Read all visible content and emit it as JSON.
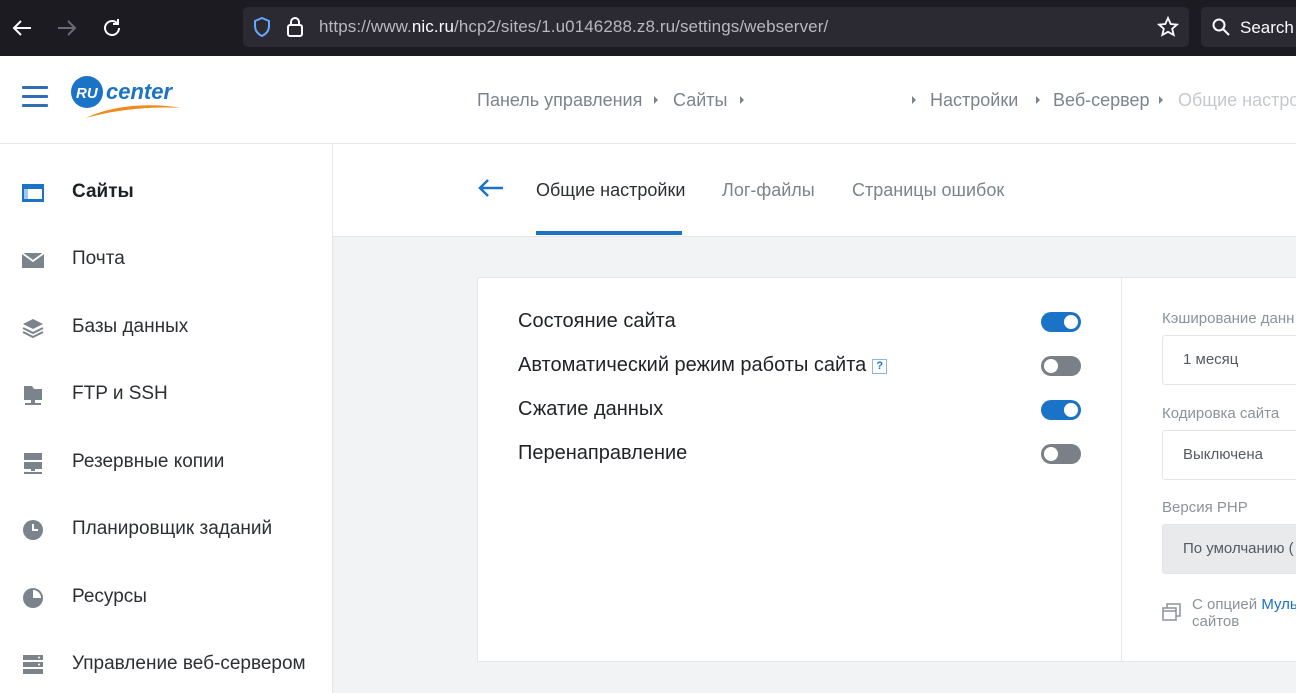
{
  "browser": {
    "url_prefix": "https://www.",
    "url_domain": "nic.ru",
    "url_path": "/hcp2/sites/1.u0146288.z8.ru/settings/webserver/",
    "search_label": "Search"
  },
  "header": {
    "logo_text_ru": "RU",
    "logo_text_center": "center",
    "breadcrumbs": [
      "Панель управления",
      "Сайты",
      "Настройки",
      "Веб-сервер",
      "Общие настро"
    ]
  },
  "sidebar": {
    "items": [
      {
        "label": "Сайты",
        "icon": "sites-icon"
      },
      {
        "label": "Почта",
        "icon": "mail-icon"
      },
      {
        "label": "Базы данных",
        "icon": "databases-icon"
      },
      {
        "label": "FTP и SSH",
        "icon": "ftp-icon"
      },
      {
        "label": "Резервные копии",
        "icon": "backup-icon"
      },
      {
        "label": "Планировщик заданий",
        "icon": "clock-icon"
      },
      {
        "label": "Ресурсы",
        "icon": "resources-icon"
      },
      {
        "label": "Управление веб-сервером",
        "icon": "server-icon"
      }
    ]
  },
  "tabs": [
    "Общие настройки",
    "Лог-файлы",
    "Страницы ошибок"
  ],
  "options": [
    {
      "label": "Состояние сайта",
      "enabled": true
    },
    {
      "label": "Автоматический режим работы сайта",
      "enabled": false,
      "help": "?"
    },
    {
      "label": "Сжатие данных",
      "enabled": true
    },
    {
      "label": "Перенаправление",
      "enabled": false
    }
  ],
  "settings": {
    "caching_label": "Кэширование данн",
    "caching_value": "1 месяц",
    "encoding_label": "Кодировка сайта",
    "encoding_value": "Выключена",
    "php_label": "Версия PHP",
    "php_value": "По умолчанию (",
    "note_prefix": "С опцией ",
    "note_link": "Муль",
    "note_suffix": "сайтов"
  },
  "colors": {
    "accent": "#1a73c6",
    "logo_orange": "#f08a1c"
  }
}
